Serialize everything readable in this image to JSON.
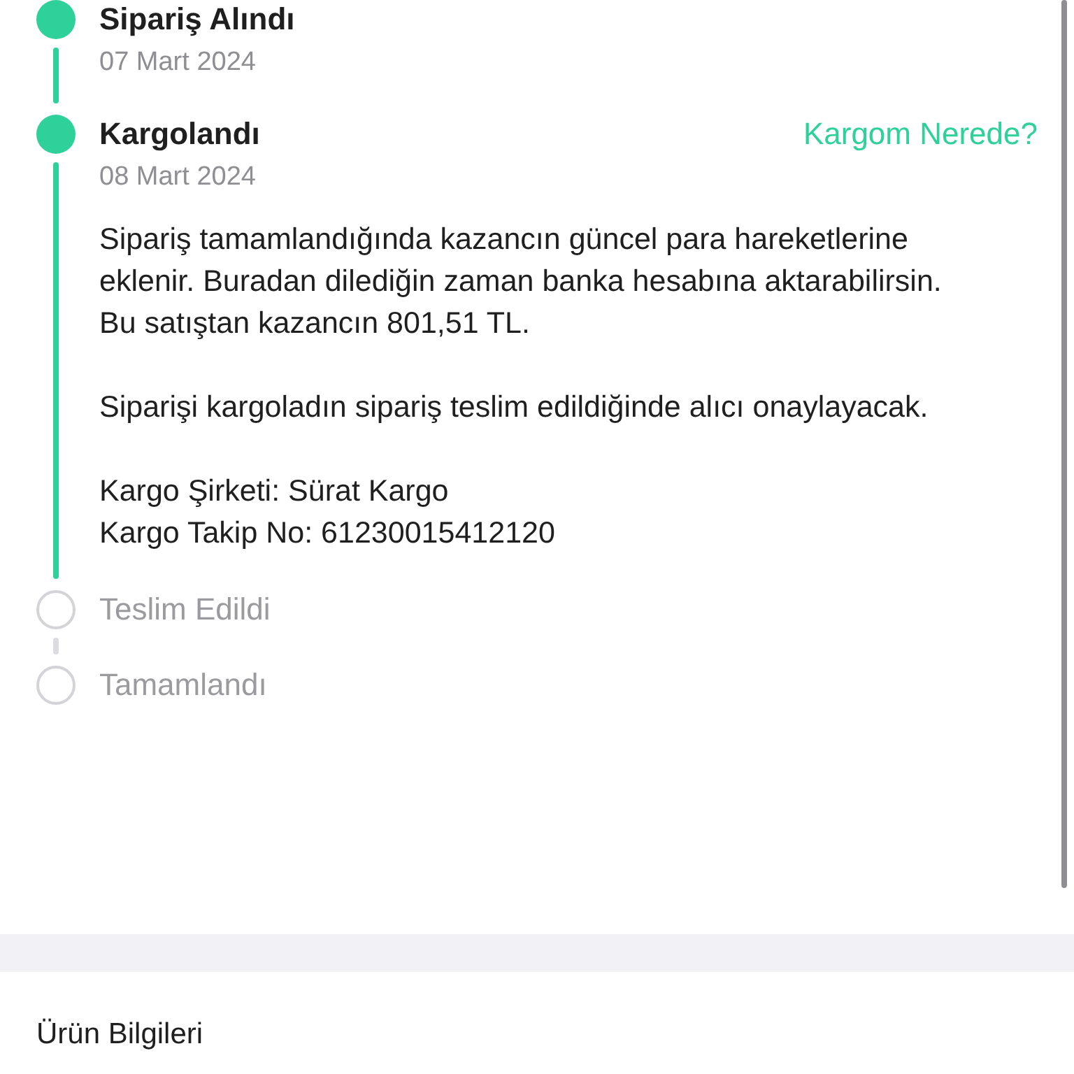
{
  "timeline": {
    "steps": [
      {
        "title": "Sipariş Alındı",
        "date": "07 Mart 2024",
        "completed": true
      },
      {
        "title": "Kargolandı",
        "date": "08 Mart 2024",
        "completed": true,
        "link": "Kargom Nerede?",
        "paragraphs": [
          [
            "Sipariş tamamlandığında kazancın güncel para hareketlerine eklenir. Buradan dilediğin zaman banka hesabına aktarabilirsin.",
            "Bu satıştan kazancın 801,51 TL."
          ],
          [
            "Siparişi kargoladın sipariş teslim edildiğinde alıcı onaylayacak."
          ],
          [
            "Kargo Şirketi: Sürat Kargo",
            "Kargo Takip No: 61230015412120"
          ]
        ]
      },
      {
        "title": "Teslim Edildi",
        "completed": false
      },
      {
        "title": "Tamamlandı",
        "completed": false
      }
    ]
  },
  "product_section": {
    "title": "Ürün Bilgileri"
  }
}
